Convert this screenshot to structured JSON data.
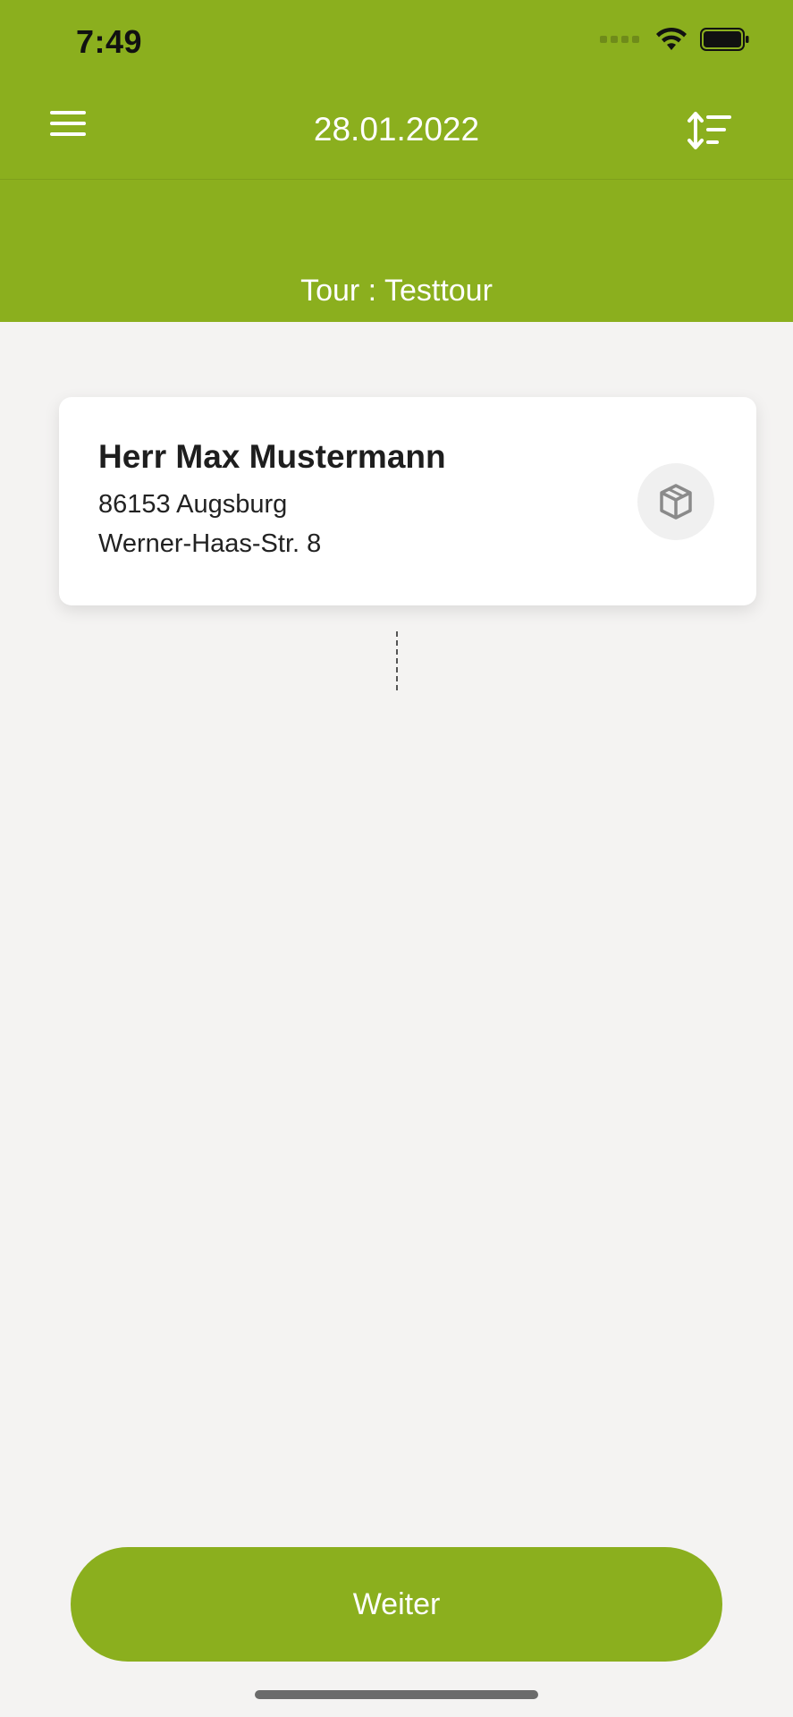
{
  "status_bar": {
    "time": "7:49",
    "icons": [
      "cellular-signal-icon",
      "wifi-icon",
      "battery-icon"
    ]
  },
  "app_bar": {
    "title": "28.01.2022",
    "menu_icon": "hamburger-menu-icon",
    "sort_icon": "sort-icon"
  },
  "tour": {
    "label": "Tour : Testtour"
  },
  "stops": [
    {
      "name": "Herr Max Mustermann",
      "city": "86153 Augsburg",
      "street": "Werner-Haas-Str. 8",
      "icon": "package-icon"
    }
  ],
  "actions": {
    "continue_label": "Weiter"
  },
  "colors": {
    "accent": "#8baf1e",
    "background": "#f4f3f2",
    "card": "#ffffff",
    "text": "#1e1e1e"
  }
}
